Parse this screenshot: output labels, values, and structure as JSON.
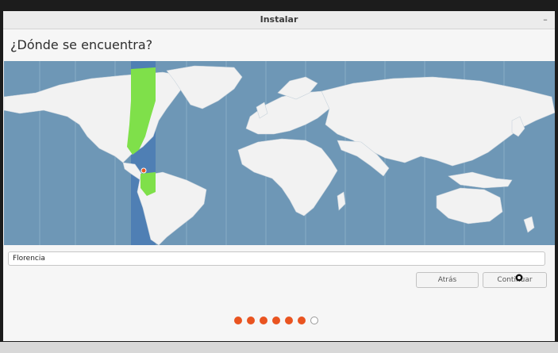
{
  "window": {
    "title": "Instalar",
    "minimize_icon": "minimize-icon"
  },
  "page": {
    "heading": "¿Dónde se encuentra?"
  },
  "map": {
    "selected_timezone_highlight": "#7fe04a",
    "ocean_color": "#6e97b6",
    "land_color": "#f2f2f2"
  },
  "location": {
    "value": "Florencia"
  },
  "buttons": {
    "back_label": "Atrás",
    "continue_label": "Continuar"
  },
  "progress": {
    "completed_steps": 6,
    "total_steps": 7
  },
  "colors": {
    "accent": "#e95420"
  }
}
